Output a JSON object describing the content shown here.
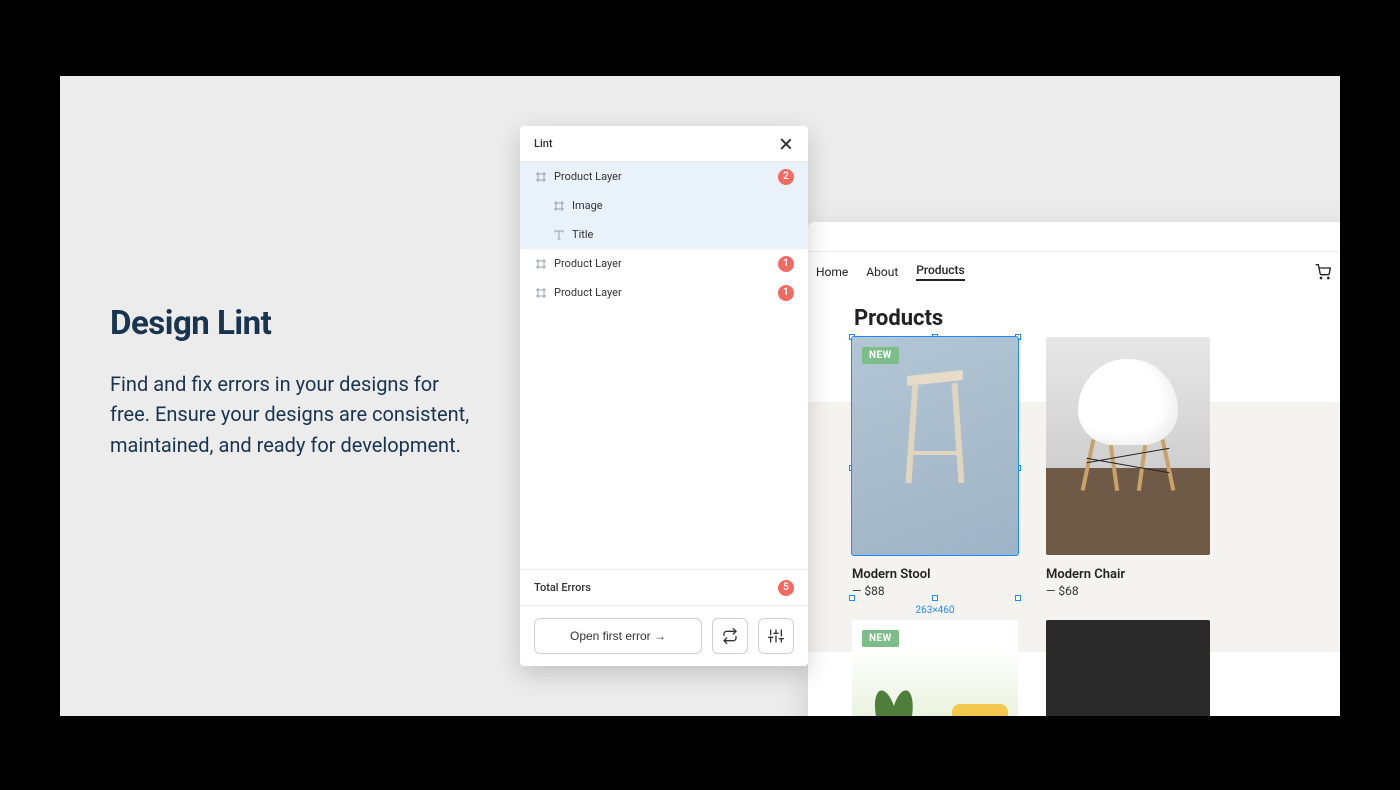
{
  "copy": {
    "title": "Design Lint",
    "body": "Find and fix errors in your designs for free. Ensure your designs are consistent, maintained, and ready for development."
  },
  "panel": {
    "title": "Lint",
    "layers": [
      {
        "icon": "frame",
        "label": "Product Layer",
        "badge": "2",
        "selected": true,
        "indent": 0
      },
      {
        "icon": "frame",
        "label": "Image",
        "selected": true,
        "indent": 1
      },
      {
        "icon": "text",
        "label": "Title",
        "selected": true,
        "indent": 1
      },
      {
        "icon": "frame",
        "label": "Product Layer",
        "badge": "1",
        "indent": 0
      },
      {
        "icon": "frame",
        "label": "Product Layer",
        "badge": "1",
        "indent": 0
      }
    ],
    "total_label": "Total Errors",
    "total_badge": "5",
    "open_label": "Open first error →"
  },
  "preview": {
    "nav": {
      "home": "Home",
      "about": "About",
      "products": "Products"
    },
    "page_title": "Products",
    "products": [
      {
        "title": "Modern Stool",
        "price": "— $88",
        "new_label": "NEW",
        "selected_dims": "263×460"
      },
      {
        "title": "Modern Chair",
        "price": "— $68"
      },
      {
        "new_label": "NEW"
      },
      {}
    ]
  },
  "colors": {
    "badge": "#f36a62",
    "selection": "#1e88ff",
    "new": "#7dbd8a"
  }
}
